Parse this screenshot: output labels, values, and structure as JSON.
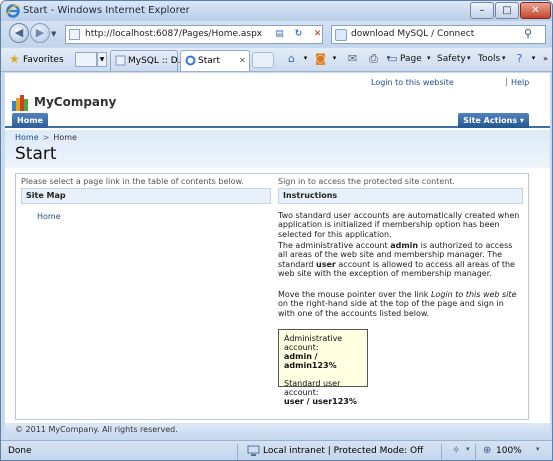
{
  "window": {
    "title": "Start - Windows Internet Explorer",
    "minimize": "–",
    "maximize": "□",
    "close": "✕"
  },
  "address": {
    "url": "http://localhost:6087/Pages/Home.aspx"
  },
  "search": {
    "value": "download MySQL / Connect"
  },
  "favorites": {
    "label": "Favorites",
    "tabs": [
      {
        "label": "MySQL :: D..."
      },
      {
        "label": "Start"
      }
    ]
  },
  "commands": {
    "page": "Page",
    "safety": "Safety",
    "tools": "Tools"
  },
  "site": {
    "login_link": "Login to this website",
    "help_link": "Help",
    "company": "MyCompany",
    "menu_home": "Home",
    "site_actions": "Site Actions ▾",
    "breadcrumb": {
      "root": "Home",
      "sep": ">",
      "current": "Home"
    },
    "page_title": "Start"
  },
  "content": {
    "left_hint": "Please select a page link in the table of contents below.",
    "right_hint": "Sign in to access the protected site content.",
    "sitemap_header": "Site Map",
    "sitemap_home": "Home",
    "instructions_header": "Instructions",
    "para1": "Two standard user accounts are automatically created when application is initialized if membership option has been selected for this application.",
    "para2_a": "The administrative account ",
    "para2_admin": "admin",
    "para2_b": " is authorized to access all areas of the web site and membership manager. The standard ",
    "para2_user": "user",
    "para2_c": " account is allowed to access all areas of the web site with the exception of membership manager.",
    "para3_a": "Move the mouse pointer over the link ",
    "para3_link": "Login to this web site",
    "para3_b": " on the right-hand side at the top of the page and sign in with one of the accounts listed below.",
    "admin_label": "Administrative account:",
    "admin_value": "admin / admin123%",
    "user_label": "Standard user account:",
    "user_value": "user / user123%"
  },
  "footer": {
    "copyright": "© 2011 MyCompany. All rights reserved."
  },
  "status": {
    "text": "Done",
    "zone": "Local intranet | Protected Mode: Off",
    "zoom": "100%"
  }
}
